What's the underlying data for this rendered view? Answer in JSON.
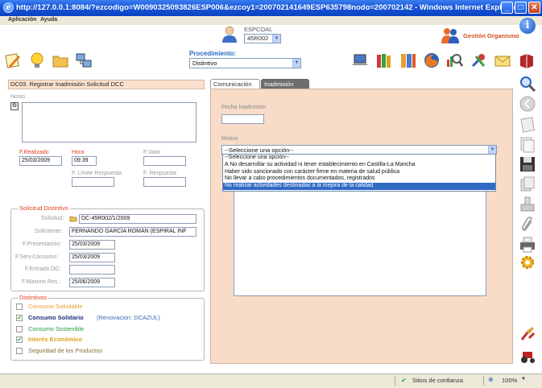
{
  "window": {
    "title": "http://127.0.0.1:8084/?ezcodigo=W0090325093826ESP006&ezcoy1=200702141649ESP635798nodo=200702142 - Windows Internet Explorer"
  },
  "menu": {
    "items": [
      "Aplicación",
      "Ayuda"
    ]
  },
  "header": {
    "espcoal_label": "ESPCOAL",
    "espcoal_value": "45R002",
    "gestion_label": "Gestión Organismo",
    "procedimiento_label": "Procedimiento:",
    "procedimiento_value": "Distintivo"
  },
  "form": {
    "section_title": "DC03. Registrar Inadmisión Solicitud DCC",
    "notas_label": "Notas",
    "notas_value": "",
    "f_realizado_label": "F.Realizado",
    "f_realizado_value": "25/03/2009",
    "hora_label": "Hora",
    "hora_value": "09:39",
    "f_valor_label": "F.Valor",
    "f_valor_value": "",
    "f_limite_label": "F. Límite Respuesta",
    "f_limite_value": "",
    "f_respuesta_label": "F. Respuesta",
    "f_respuesta_value": ""
  },
  "solicitud": {
    "legend": "Solicitud Distintivo",
    "fields": [
      {
        "label": "Solicitud:",
        "value": "DC-45R002/1/2009"
      },
      {
        "label": "Solicitante:",
        "value": "FERNANDO GARCÍA ROMÁN (ESPIRAL INF"
      },
      {
        "label": "F.Presentación:",
        "value": "25/03/2009"
      },
      {
        "label": "F.Serv.Consumo:",
        "value": "25/03/2009"
      },
      {
        "label": "F.Entrada DG:",
        "value": ""
      },
      {
        "label": "F.Maximo Res.:",
        "value": "25/06/2009"
      }
    ]
  },
  "distintivos": {
    "legend": "Distintivos",
    "items": [
      {
        "label": "Consumo Saludable",
        "extra": "",
        "checked": false,
        "color": "#e6a030"
      },
      {
        "label": "Consumo Solidario",
        "extra": "(Renovación: DCAZUL)",
        "checked": true,
        "color": "#1a2f7a"
      },
      {
        "label": "Consumo Sostenible",
        "extra": "",
        "checked": false,
        "color": "#2a9a3c"
      },
      {
        "label": "Interés Económico",
        "extra": "",
        "checked": true,
        "color": "#e0a020"
      },
      {
        "label": "Seguridad de los Productos",
        "extra": "",
        "checked": false,
        "color": "#8a6a3a"
      }
    ]
  },
  "tabs": {
    "comunicacion": "Comunicación",
    "inadmision": "Inadmisión"
  },
  "inadmision": {
    "fecha_label": "Fecha Inadmisión",
    "fecha_value": "",
    "motivo_label": "Motivo",
    "motivo_selected": "--Seleccione una opción--",
    "options": [
      "--Seleccione una opción--",
      "A No desarrollar su actividad ni tener establecimiento en Castilla-La Mancha",
      "Haber sido sancionado con carácter firme en materia de salud pública",
      "No llevar a cabo procedimientos documentados, registrados",
      "No realizar actividades destinadas a la mejora de la calidad"
    ],
    "highlighted_option_index": 4
  },
  "status": {
    "zone": "Sitios de confianza",
    "zoom": "100%"
  }
}
